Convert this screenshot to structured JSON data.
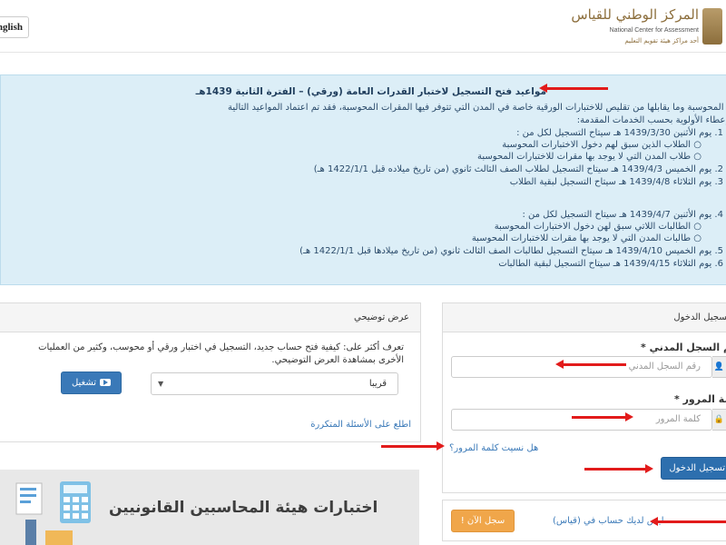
{
  "header": {
    "language_button": "English",
    "logo_ar": "المركز الوطني للقياس",
    "logo_en": "National Center for Assessment",
    "logo_sub": "أحد مراكز هيئة تقويم التعليم"
  },
  "announcement": {
    "title": "مواعيد فتح التسجيل لاختبار القدرات العامة (ورقي) – الفترة الثانية 1439هـ",
    "lines": [
      "بناءً على خطة المركز في التحول إلى الاختبارات المحوسبة وما يقابلها من تقليص للاختبارات الورقية خاصة في المدن التي تتوفر فيها المقرات المحوسبة، فقد تم اعتماد المواعيد التالية",
      "وإعطاء الأولوية بحسب الخدمات المقدمة:",
      "1. يوم الأثنين 1439/3/30 هـ سيتاح التسجيل لكل من :",
      "الطلاب الذين سبق لهم دخول الاختبارات المحوسبة",
      "طلاب المدن التي لا يوجد بها مقرات للاختبارات المحوسبة",
      "2. يوم الخميس 1439/4/3 هـ سيتاح التسجيل لطلاب الصف الثالث ثانوي (من تاريخ ميلاده قبل 1422/1/1 هـ)",
      "3. يوم الثلاثاء 1439/4/8 هـ سيتاح التسجيل لبقية الطلاب",
      "4. يوم الأثنين 1439/4/7 هـ سيتاح التسجيل لكل من :",
      "الطالبات اللاتي سبق لهن دخول الاختبارات المحوسبة",
      "طالبات المدن التي لا يوجد بها مقرات للاختبارات المحوسبة",
      "5. يوم الخميس 1439/4/10 هـ سيتاح التسجيل لطالبات الصف الثالث ثانوي (من تاريخ ميلادها قبل 1422/1/1 هـ)",
      "6. يوم الثلاثاء 1439/4/15 هـ سيتاح التسجيل لبقية الطالبات"
    ]
  },
  "demo": {
    "header": "عرض توضيحي",
    "text_line1": "تعرف أكثر على: كيفية فتح حساب جديد، التسجيل في اختبار ورقي أو محوسب، وكثير من العمليات",
    "text_line2": "الأخرى بمشاهدة العرض التوضيحي.",
    "select_value": "قريبا",
    "play_button": "تشغيل",
    "faq_link": "اطلع على الأسئلة المتكررة"
  },
  "login": {
    "header": "تسجيل الدخول",
    "civil_label": "رقم السجل المدني *",
    "civil_placeholder": "رقم السجل المدني",
    "password_label": "كلمة المرور *",
    "password_placeholder": "كلمة المرور",
    "forgot_link": "هل نسيت كلمة المرور؟",
    "login_button": "تسجيل الدخول",
    "no_account": "ليس لديك حساب في (قياس)",
    "signup_button": "سجل الآن !"
  },
  "banner": {
    "title": "اختبارات هيئة المحاسبين القانونيين"
  },
  "colors": {
    "accent": "#2d6fae",
    "annotation_arrow": "#e21b1b",
    "signup": "#f0a64a",
    "announcement_bg": "#dceef7"
  }
}
